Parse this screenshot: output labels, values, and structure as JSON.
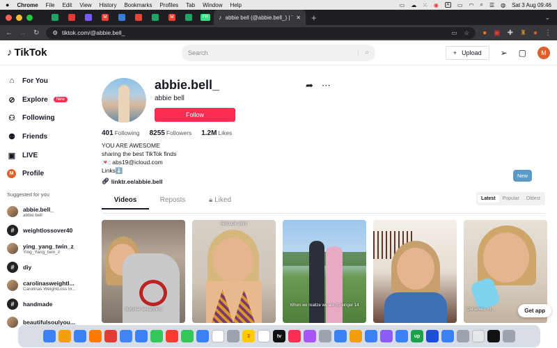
{
  "menubar": {
    "apple": "",
    "items": [
      "Chrome",
      "File",
      "Edit",
      "View",
      "History",
      "Bookmarks",
      "Profiles",
      "Tab",
      "Window",
      "Help"
    ],
    "datetime": "Sat 3 Aug  09:46",
    "status_letter": "A"
  },
  "browser": {
    "active_tab_title": "abbie bell (@abbie.bell_) | TikTok",
    "url": "tiktok.com/@abbie.bell_",
    "pinned_tab_colors": [
      "#1fa463",
      "#e53935",
      "#7a5af8",
      "#ea4335",
      "#3a7bd5",
      "#ea4335",
      "#1fa463",
      "#ea4335",
      "#1fa463",
      "#3ddc84"
    ],
    "pinned_tab_letters": [
      "",
      "",
      "",
      "M",
      "",
      "",
      "",
      "M",
      "",
      "FR"
    ]
  },
  "tiktok": {
    "logo": "TikTok",
    "search_placeholder": "Search",
    "upload_label": "Upload",
    "avatar_letter": "M"
  },
  "sidebar": {
    "nav": [
      {
        "label": "For You",
        "icon": "home-icon"
      },
      {
        "label": "Explore",
        "icon": "compass-icon",
        "badge": "New"
      },
      {
        "label": "Following",
        "icon": "following-icon"
      },
      {
        "label": "Friends",
        "icon": "friends-icon"
      },
      {
        "label": "LIVE",
        "icon": "live-icon"
      },
      {
        "label": "Profile",
        "icon": "profile-icon",
        "letter": "M"
      }
    ],
    "suggested_title": "Suggested for you",
    "accounts": [
      {
        "name": "abbie.bell_",
        "sub": "abbie bell",
        "type": "photo"
      },
      {
        "name": "weightlossover40",
        "sub": "",
        "type": "hash"
      },
      {
        "name": "ying_yang_twin_z",
        "sub": "Ying_Yang_twin_z",
        "type": "photo"
      },
      {
        "name": "diy",
        "sub": "",
        "type": "hash"
      },
      {
        "name": "carolinasweightl...",
        "sub": "Carolinas WeightLoss In...",
        "type": "photo"
      },
      {
        "name": "handmade",
        "sub": "",
        "type": "hash"
      },
      {
        "name": "beautifulsoulyou...",
        "sub": "",
        "type": "photo"
      }
    ]
  },
  "profile": {
    "username": "abbie.bell_",
    "display_name": "abbie bell",
    "follow_label": "Follow",
    "stats": [
      {
        "value": "401",
        "label": "Following"
      },
      {
        "value": "8255",
        "label": "Followers"
      },
      {
        "value": "1.2M",
        "label": "Likes"
      }
    ],
    "bio": [
      "YOU ARE AWESOME",
      "sharing the best TikTok finds",
      "💌: abs19@icloud.com",
      "Links⬇️"
    ],
    "link": "linktr.ee/abbie.bell"
  },
  "tabs": {
    "items": [
      "Videos",
      "Reposts",
      "Liked"
    ],
    "sort": [
      "Latest",
      "Popular",
      "Oldest"
    ],
    "new_tooltip": "New"
  },
  "videos": [
    {
      "caption": "Surprise sweatshirts",
      "top": ""
    },
    {
      "caption": "",
      "top": "Bernook swim"
    },
    {
      "caption": "When we realize we are no longer 14",
      "top": ""
    },
    {
      "caption": "",
      "top": ""
    },
    {
      "caption": "Ourselves, m...",
      "top": ""
    }
  ],
  "get_app": "Get app",
  "dock_colors": [
    "#3b82f6",
    "#f59e0b",
    "#3b82f6",
    "#ff7a00",
    "#e53935",
    "#4285f4",
    "#3b82f6",
    "#34c759",
    "#ff3b30",
    "#34c759",
    "#3b82f6",
    "#ffffff",
    "#9ca3af",
    "#ffcc00",
    "#ffffff",
    "#111111",
    "#ff2d55",
    "#a855f7",
    "#9ca3af",
    "#3b82f6",
    "#f59e0b",
    "#3b82f6",
    "#8b5cf6",
    "#3b82f6",
    "#16a34a",
    "#1d4ed8",
    "#3b82f6",
    "#9ca3af",
    "#e5e7eb",
    "#111111",
    "#9ca3af"
  ],
  "dock_calendar_day": "3",
  "dock_tv_label": "tv",
  "dock_up_label": "up"
}
